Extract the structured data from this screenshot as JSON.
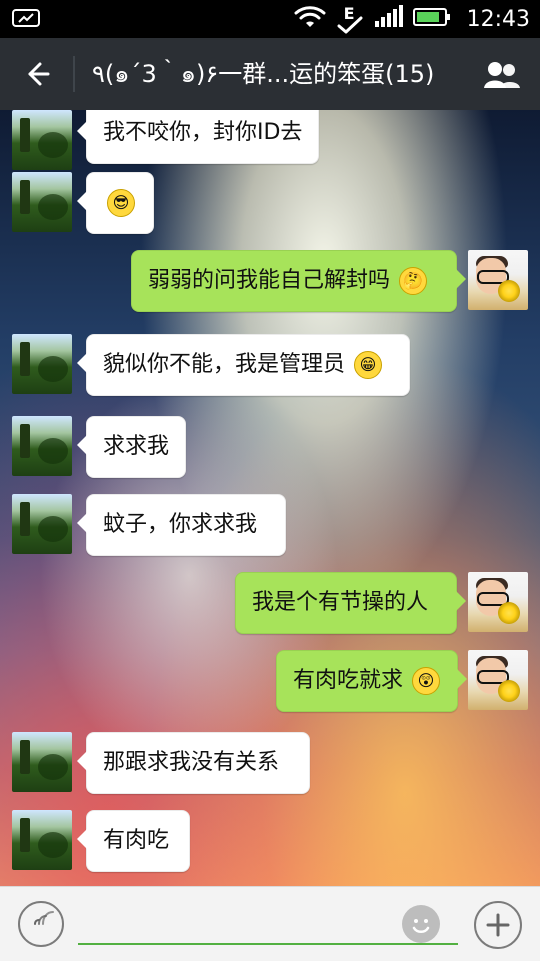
{
  "status_bar": {
    "time": "12:43",
    "network_type": "E"
  },
  "top_bar": {
    "title": "٩(๑´3｀๑)۶一群...运的笨蛋(15)"
  },
  "chat": {
    "messages": [
      {
        "side": "left",
        "text": "我不咬你，封你ID去"
      },
      {
        "side": "left",
        "emoji": "cool-face-emoji"
      },
      {
        "side": "right",
        "text": "弱弱的问我能自己解封吗",
        "emoji": "questioning-face-emoji"
      },
      {
        "side": "left",
        "text": "貌似你不能，我是管理员",
        "emoji": "grinning-face-emoji"
      },
      {
        "side": "left",
        "text": "求求我"
      },
      {
        "side": "left",
        "text": "蚊子，你求求我"
      },
      {
        "side": "right",
        "text": "我是个有节操的人"
      },
      {
        "side": "right",
        "text": "有肉吃就求",
        "emoji": "surprised-face-emoji"
      },
      {
        "side": "left",
        "text": "那跟求我没有关系"
      },
      {
        "side": "left",
        "text": "有肉吃"
      }
    ]
  },
  "input_bar": {
    "value": "",
    "placeholder": ""
  },
  "colors": {
    "status_bar_bg": "#000000",
    "top_bar_bg": "#2b2f34",
    "left_bubble_bg": "#ffffff",
    "right_bubble_bg": "#a7e35a",
    "input_underline": "#52b041"
  }
}
